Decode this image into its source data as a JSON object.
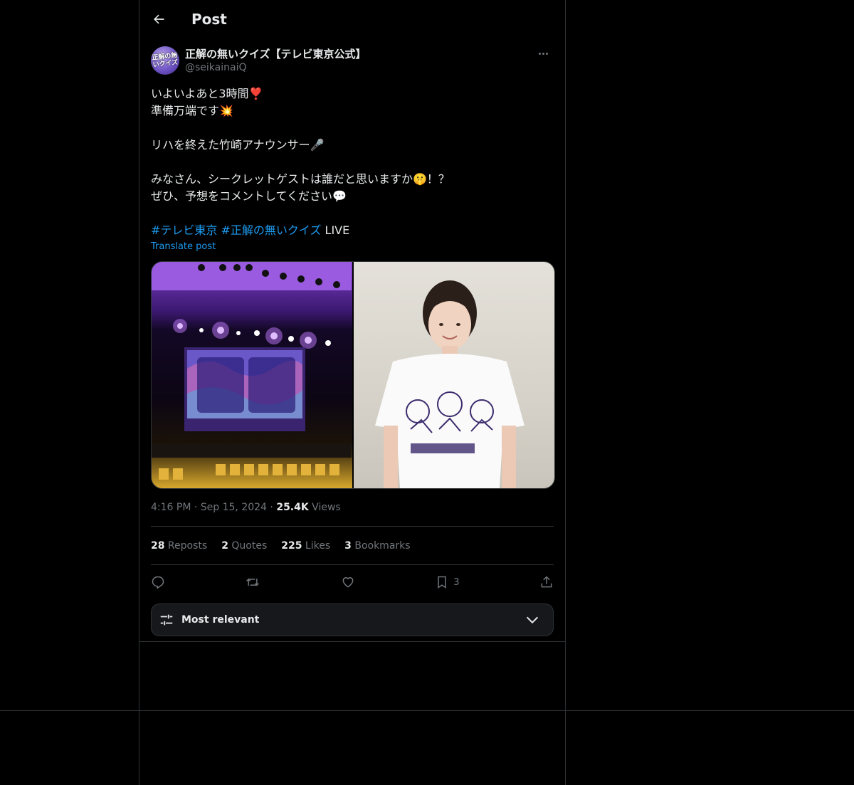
{
  "header": {
    "title": "Post"
  },
  "author": {
    "display_name": "正解の無いクイズ【テレビ東京公式】",
    "handle": "@seikainaiQ",
    "avatar_text": "正解の無いクイズ"
  },
  "tweet": {
    "lines": [
      "いよいよあと3時間❣️",
      "準備万端です💥",
      "",
      "リハを終えた竹崎アナウンサー🎤",
      "",
      "みなさん、シークレットゲストは誰だと思いますか🤫！？",
      "ぜひ、予想をコメントしてください💬",
      ""
    ],
    "hashtag1": "#テレビ東京",
    "hashtag2": "#正解の無いクイズ",
    "tail": " LIVE",
    "translate": "Translate post"
  },
  "meta": {
    "time": "4:16 PM",
    "sep1": " · ",
    "date": "Sep 15, 2024",
    "sep2": " · ",
    "views_count": "25.4K",
    "views_label": " Views"
  },
  "stats": {
    "reposts_count": "28",
    "reposts_label": " Reposts",
    "quotes_count": "2",
    "quotes_label": " Quotes",
    "likes_count": "225",
    "likes_label": " Likes",
    "bookmarks_count": "3",
    "bookmarks_label": " Bookmarks"
  },
  "actions": {
    "bookmark_count": "3"
  },
  "sort": {
    "label": "Most relevant"
  },
  "colors": {
    "background": "#000000",
    "text": "#e7e9ea",
    "muted": "#71767b",
    "accent": "#1d9bf0",
    "border": "#2f3336"
  },
  "icons": [
    "arrow-left-icon",
    "more-icon",
    "reply-icon",
    "repost-icon",
    "like-icon",
    "bookmark-icon",
    "share-icon",
    "sliders-icon",
    "chevron-down-icon"
  ]
}
